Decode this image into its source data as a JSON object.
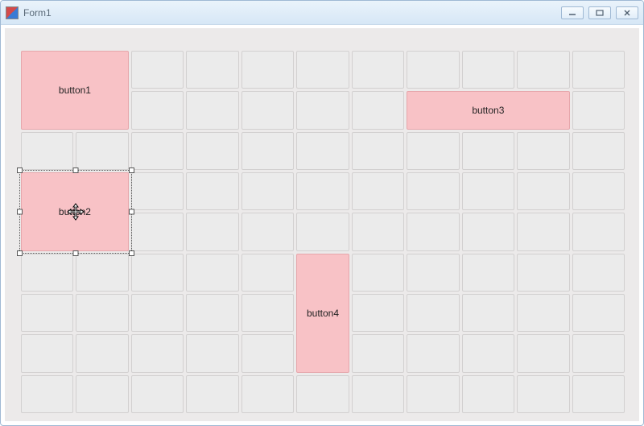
{
  "window": {
    "title": "Form1"
  },
  "buttons": {
    "b1": "button1",
    "b2": "button2",
    "b3": "button3",
    "b4": "button4"
  },
  "buttonColor": "#f8c2c6",
  "grid": {
    "cols": 11,
    "rows": 9
  },
  "placement": {
    "b1": {
      "col": 1,
      "row": 1,
      "colSpan": 2,
      "rowSpan": 2
    },
    "b2": {
      "col": 1,
      "row": 4,
      "colSpan": 2,
      "rowSpan": 2
    },
    "b3": {
      "col": 8,
      "row": 2,
      "colSpan": 3,
      "rowSpan": 1
    },
    "b4": {
      "col": 6,
      "row": 6,
      "colSpan": 1,
      "rowSpan": 3
    }
  },
  "selected": "b2"
}
